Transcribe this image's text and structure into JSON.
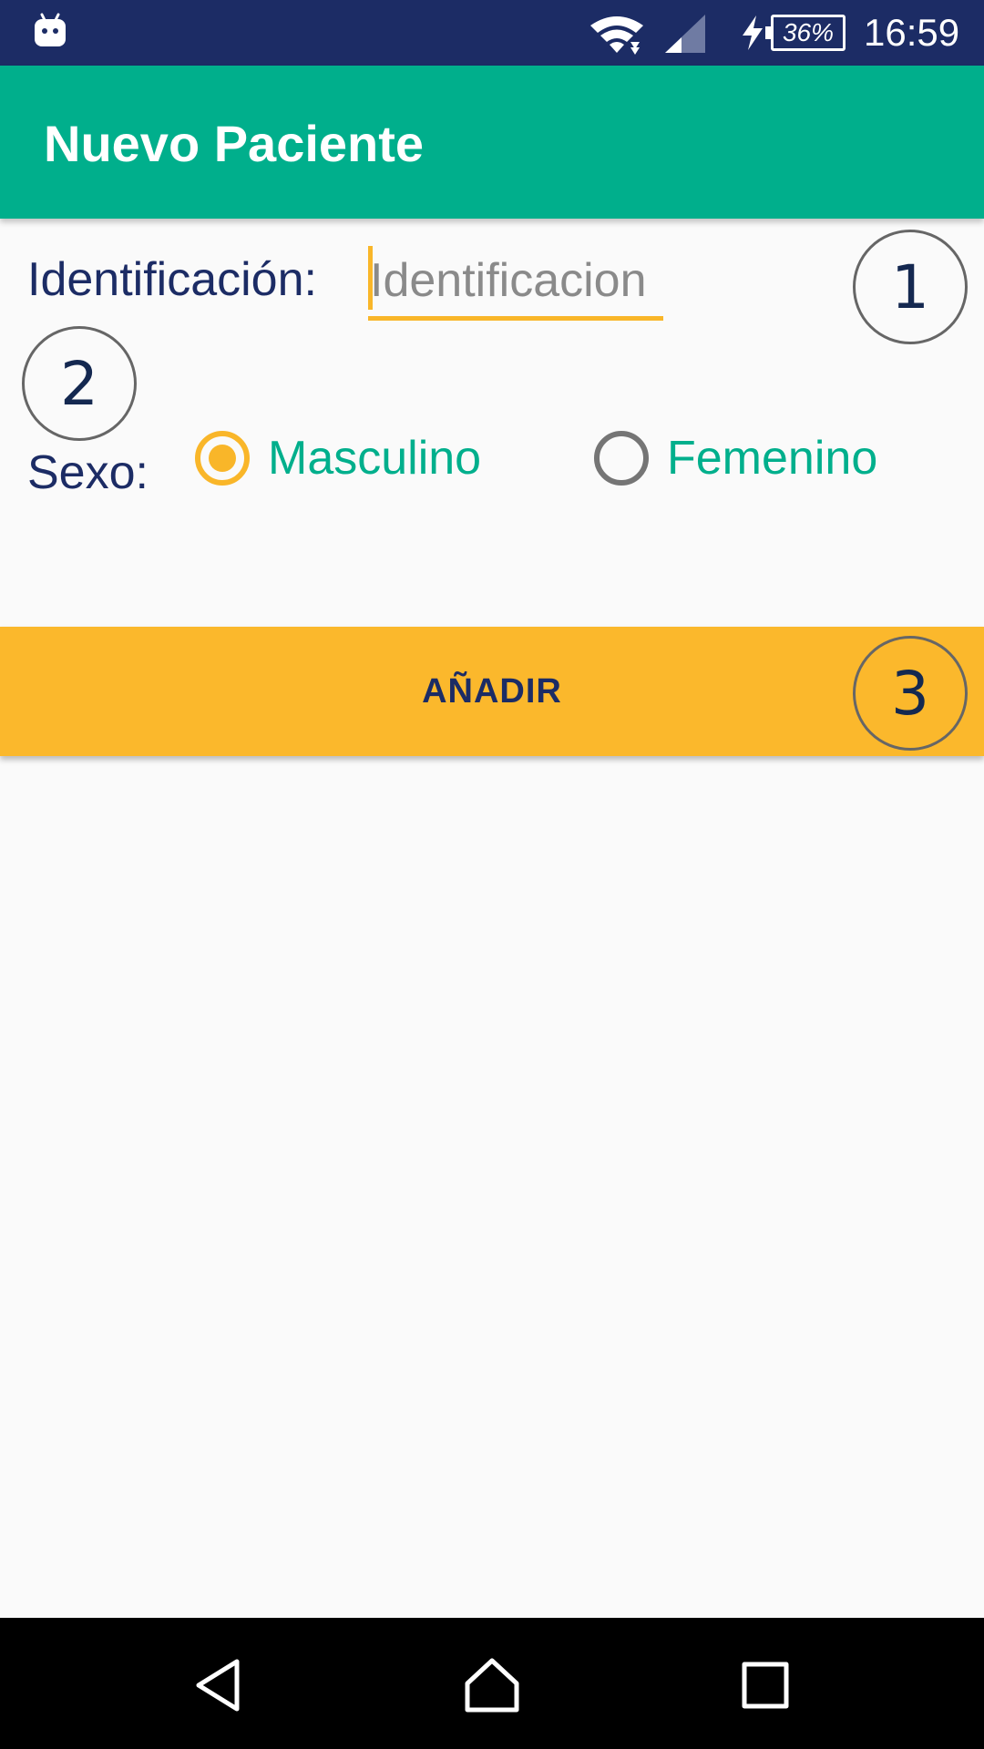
{
  "status_bar": {
    "battery": "36%",
    "time": "16:59",
    "icons": [
      "android-icon",
      "wifi-icon",
      "signal-icon",
      "charging-icon",
      "battery-icon"
    ]
  },
  "app_bar": {
    "title": "Nuevo Paciente"
  },
  "form": {
    "identificacion_label": "Identificación:",
    "identificacion_placeholder": "Identificacion",
    "identificacion_value": "",
    "sexo_label": "Sexo:",
    "sexo_options": [
      {
        "label": "Masculino",
        "checked": true
      },
      {
        "label": "Femenino",
        "checked": false
      }
    ]
  },
  "add_button": {
    "label": "AÑADIR"
  },
  "annotations": [
    "1",
    "2",
    "3"
  ],
  "colors": {
    "status_bar": "#1C2C65",
    "app_bar": "#00AF8C",
    "accent": "#F9B629",
    "button": "#FBB82C",
    "label_text": "#1C2C65",
    "radio_text": "#00AF8C",
    "nav_bar": "#000000"
  },
  "nav_bar": {
    "icons": [
      "back-icon",
      "home-icon",
      "recents-icon"
    ]
  }
}
